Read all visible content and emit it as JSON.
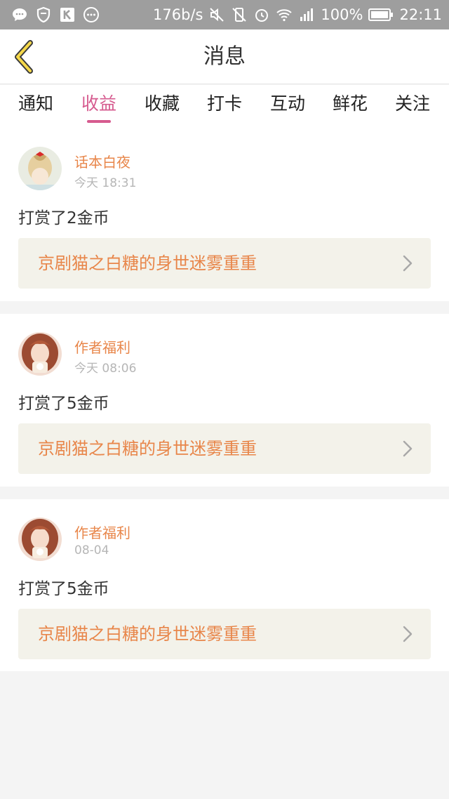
{
  "status_bar": {
    "net_speed": "176b/s",
    "battery": "100%",
    "time": "22:11"
  },
  "header": {
    "title": "消息",
    "back_icon": "chevron-left-icon"
  },
  "tabs": [
    {
      "label": "通知",
      "active": false
    },
    {
      "label": "收益",
      "active": true
    },
    {
      "label": "收藏",
      "active": false
    },
    {
      "label": "打卡",
      "active": false
    },
    {
      "label": "互动",
      "active": false
    },
    {
      "label": "鲜花",
      "active": false
    },
    {
      "label": "关注",
      "active": false
    }
  ],
  "colors": {
    "accent": "#d65b8f",
    "name_orange": "#e8864a",
    "book_bg": "#f3f2ea"
  },
  "messages": [
    {
      "user": "话本白夜",
      "time": "今天 18:31",
      "text": "打赏了2金币",
      "book": "京剧猫之白糖的身世迷雾重重"
    },
    {
      "user": "作者福利",
      "time": "今天 08:06",
      "text": "打赏了5金币",
      "book": "京剧猫之白糖的身世迷雾重重"
    },
    {
      "user": "作者福利",
      "time": "08-04",
      "text": "打赏了5金币",
      "book": "京剧猫之白糖的身世迷雾重重"
    }
  ]
}
